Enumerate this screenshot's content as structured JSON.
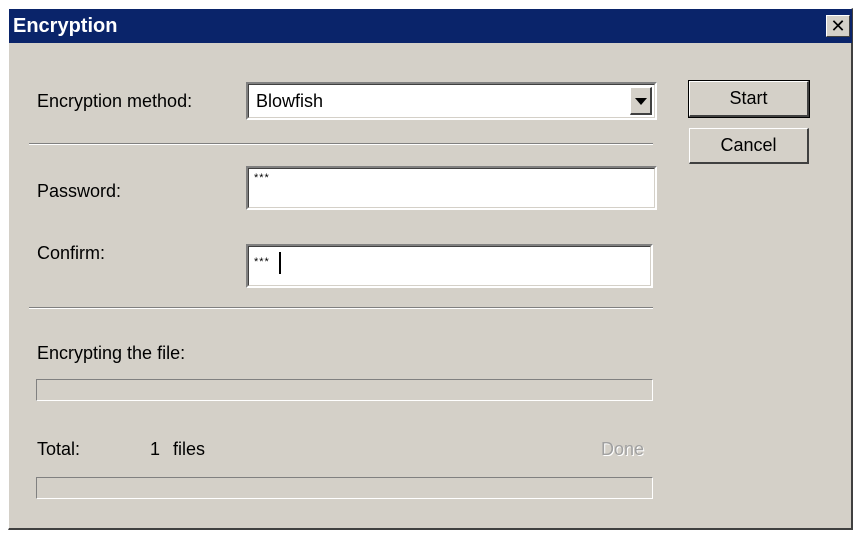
{
  "window": {
    "title": "Encryption",
    "close_glyph": "✕"
  },
  "form": {
    "method_label": "Encryption method:",
    "method_value": "Blowfish",
    "password_label": "Password:",
    "password_value": "***",
    "confirm_label": "Confirm:",
    "confirm_value": "***"
  },
  "progress": {
    "file_label": "Encrypting the file:",
    "file_progress": 0,
    "total_label": "Total:",
    "total_count": "1",
    "total_unit": "files",
    "done_label": "Done",
    "total_progress": 0
  },
  "buttons": {
    "start": "Start",
    "cancel": "Cancel"
  },
  "colors": {
    "titlebar": "#0a246a",
    "face": "#d4d0c8",
    "done_disabled": "#a0a0a0"
  },
  "icons": {
    "close": "close-icon",
    "dropdown": "chevron-down-icon"
  }
}
